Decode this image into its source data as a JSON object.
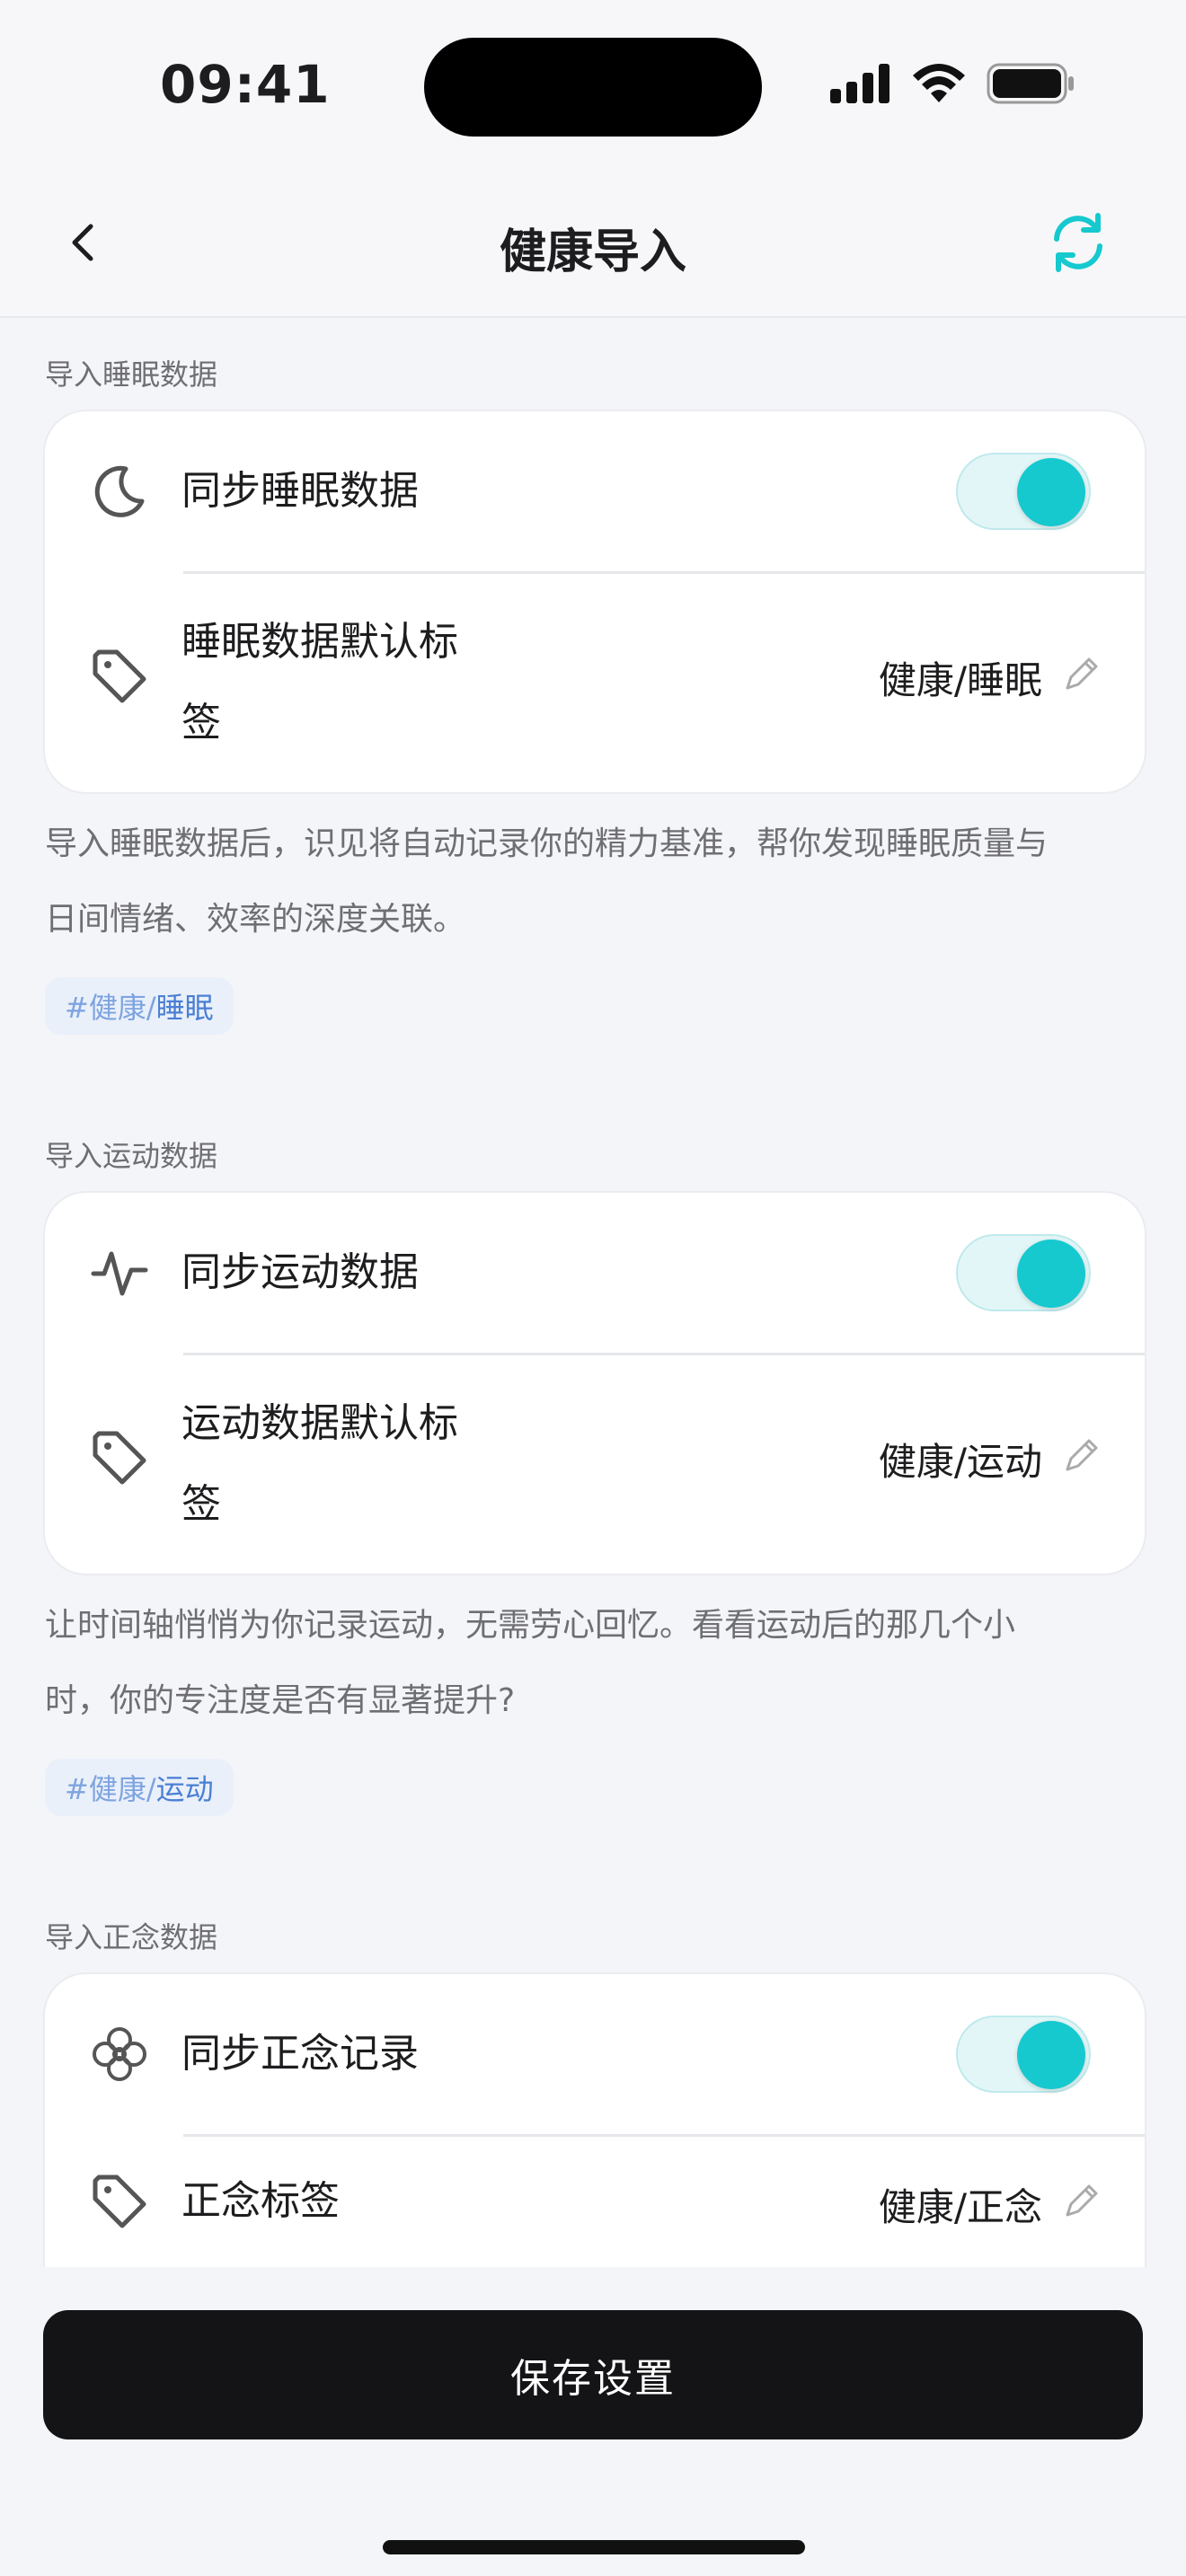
{
  "status_bar": {
    "time": "09:41"
  },
  "nav": {
    "title": "健康导入"
  },
  "sections": [
    {
      "label": "导入睡眠数据",
      "sync_label": "同步睡眠数据",
      "sync_on": true,
      "tag_label_line1": "睡眠数据默认标",
      "tag_label_line2": "签",
      "tag_value": "健康/睡眠",
      "description_line1": "导入睡眠数据后，识见将自动记录你的精力基准，帮你发现睡眠质量与",
      "description_line2": "日间情绪、效率的深度关联。",
      "chip_prefix": "#健康/",
      "chip_suffix": "睡眠"
    },
    {
      "label": "导入运动数据",
      "sync_label": "同步运动数据",
      "sync_on": true,
      "tag_label_line1": "运动数据默认标",
      "tag_label_line2": "签",
      "tag_value": "健康/运动",
      "description_line1": "让时间轴悄悄为你记录运动，无需劳心回忆。看看运动后的那几个小",
      "description_line2": "时，你的专注度是否有显著提升?",
      "chip_prefix": "#健康/",
      "chip_suffix": "运动"
    },
    {
      "label": "导入正念数据",
      "sync_label": "同步正念记录",
      "sync_on": true,
      "tag_label_line1": "正念标签",
      "tag_value": "健康/正念"
    }
  ],
  "save_button": {
    "label": "保存设置"
  },
  "colors": {
    "accent": "#15c9cf",
    "chip_text": "#4a7fd4",
    "button_bg": "#141416"
  }
}
